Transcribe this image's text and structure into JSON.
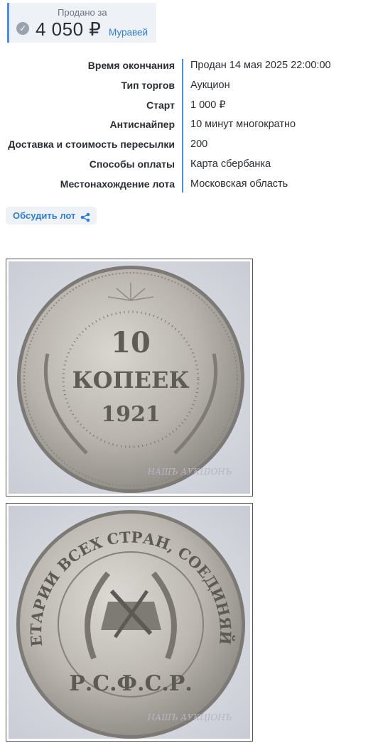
{
  "sold": {
    "label": "Продано за",
    "amount": "4 050 ₽",
    "buyer": "Муравей",
    "check_icon": "check-circle-icon"
  },
  "details": [
    {
      "key": "Время окончания",
      "value": "Продан 14 мая 2025 22:00:00"
    },
    {
      "key": "Тип торгов",
      "value": "Аукцион"
    },
    {
      "key": "Старт",
      "value": "1 000 ₽"
    },
    {
      "key": "Антиснайпер",
      "value": "10 минут многократно"
    },
    {
      "key": "Доставка и стоимость пересылки",
      "value": "200"
    },
    {
      "key": "Способы оплаты",
      "value": "Карта сбербанка"
    },
    {
      "key": "Местонахождение лота",
      "value": "Московская область"
    }
  ],
  "discuss": {
    "label": "Обсудить лот",
    "icon": "share-icon"
  },
  "photos": {
    "obverse": {
      "denomination": "10",
      "word": "КОПЕЕК",
      "year": "1921",
      "watermark": "НАШЪ АУКЦIОНЪ"
    },
    "reverse": {
      "legend": "ПРОЛЕТАРИИ ВСЕХ СТРАН, СОЕДИНЯЙТЕСЬ!",
      "country": "Р.С.Ф.С.Р.",
      "watermark": "НАШЪ АУКЦIОНЪ"
    }
  },
  "colors": {
    "accent": "#4a90e2",
    "link": "#2f7fd8",
    "panel": "#eef1f5"
  }
}
